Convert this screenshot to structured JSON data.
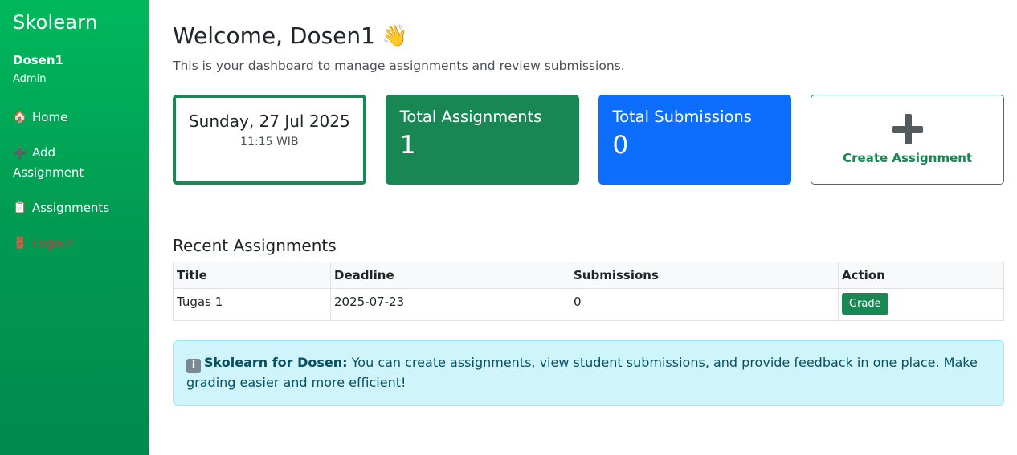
{
  "sidebar": {
    "brand": "Skolearn",
    "user_name": "Dosen1",
    "user_role": "Admin",
    "nav": {
      "home_icon": "🏠",
      "home": "Home",
      "add_icon": "➕",
      "add_line1": "Add",
      "add_line2": "Assignment",
      "assignments_icon": "📋",
      "assignments": "Assignments",
      "logout_icon": "🚪",
      "logout": "Logout"
    }
  },
  "main": {
    "welcome": "Welcome, Dosen1",
    "wave_icon": "👋",
    "subtitle": "This is your dashboard to manage assignments and review submissions.",
    "cards": {
      "date": "Sunday, 27 Jul 2025",
      "time": "11:15 WIB",
      "total_assignments_label": "Total Assignments",
      "total_assignments_value": "1",
      "total_submissions_label": "Total Submissions",
      "total_submissions_value": "0",
      "create_label": "Create Assignment"
    },
    "recent_title": "Recent Assignments",
    "table": {
      "headers": [
        "Title",
        "Deadline",
        "Submissions",
        "Action"
      ],
      "rows": [
        {
          "title": "Tugas 1",
          "deadline": "2025-07-23",
          "submissions": "0",
          "action": "Grade"
        }
      ]
    },
    "alert": {
      "icon": "i",
      "bold": "Skolearn for Dosen:",
      "text": " You can create assignments, view student submissions, and provide feedback in one place. Make grading easier and more efficient!"
    }
  },
  "colors": {
    "sidebar_start": "#00b85c",
    "success": "#198754",
    "primary": "#0d6efd",
    "danger": "#dc3545",
    "info_bg": "#cff4fc",
    "info_text": "#055160"
  }
}
